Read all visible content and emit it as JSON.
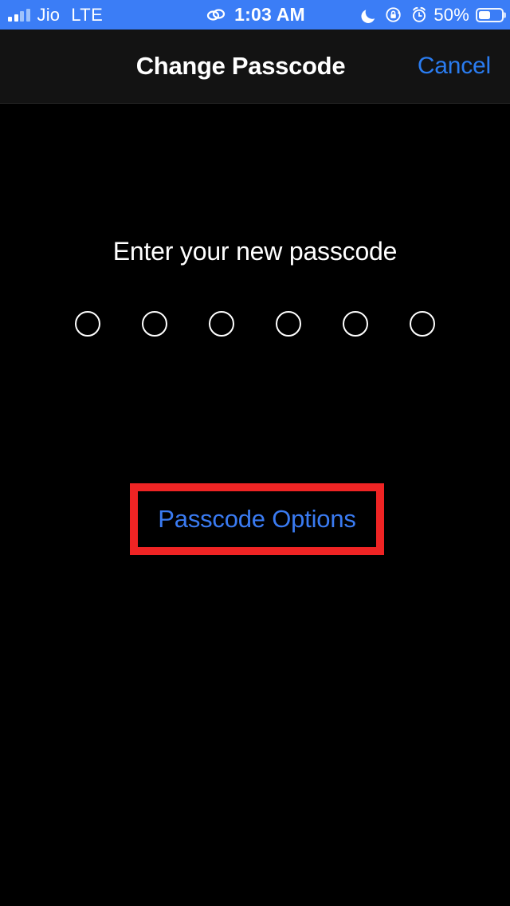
{
  "status_bar": {
    "carrier": "Jio",
    "network_type": "LTE",
    "time": "1:03 AM",
    "battery_percent": "50%",
    "battery_level": 50,
    "signal_bars_filled": 2,
    "signal_bars_total": 4,
    "icons": {
      "link": "link-icon",
      "moon": "do-not-disturb-moon-icon",
      "rotation_lock": "rotation-lock-icon",
      "alarm": "alarm-clock-icon",
      "battery": "battery-icon"
    },
    "background_color": "#3b7df6",
    "foreground_color": "#ffffff"
  },
  "nav_bar": {
    "title": "Change Passcode",
    "cancel_label": "Cancel",
    "accent_color": "#2a7cf0",
    "background_color": "#131313"
  },
  "main": {
    "prompt": "Enter your new passcode",
    "passcode": {
      "length": 6,
      "entered": 0,
      "dots": [
        false,
        false,
        false,
        false,
        false,
        false
      ]
    },
    "passcode_options_label": "Passcode Options",
    "passcode_options_color": "#3a7bf2",
    "background_color": "#000000"
  },
  "annotation": {
    "highlight_color": "#ef2424",
    "target": "Passcode Options"
  }
}
